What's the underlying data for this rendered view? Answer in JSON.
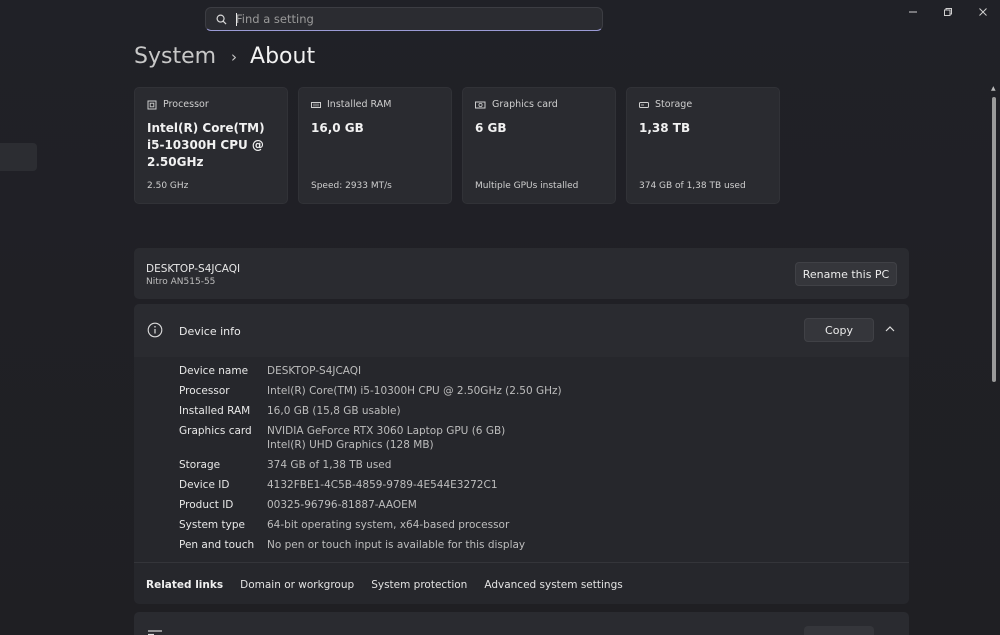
{
  "search": {
    "placeholder": "Find a setting"
  },
  "breadcrumb": {
    "parent": "System",
    "current": "About"
  },
  "cards": [
    {
      "label": "Processor",
      "icon": "processor-icon",
      "value": "Intel(R) Core(TM) i5-10300H CPU @ 2.50GHz",
      "sub": "2.50 GHz"
    },
    {
      "label": "Installed RAM",
      "icon": "ram-icon",
      "value": "16,0 GB",
      "sub": "Speed: 2933 MT/s"
    },
    {
      "label": "Graphics card",
      "icon": "graphics-card-icon",
      "value": "6 GB",
      "sub": "Multiple GPUs installed"
    },
    {
      "label": "Storage",
      "icon": "storage-icon",
      "value": "1,38 TB",
      "sub": "374 GB of 1,38 TB used"
    }
  ],
  "pc": {
    "name": "DESKTOP-S4JCAQI",
    "model": "Nitro AN515-55",
    "rename_label": "Rename this PC"
  },
  "device_info": {
    "title": "Device info",
    "copy_label": "Copy",
    "specs": [
      {
        "key": "Device name",
        "value": "DESKTOP-S4JCAQI"
      },
      {
        "key": "Processor",
        "value": "Intel(R) Core(TM) i5-10300H CPU @ 2.50GHz (2.50 GHz)"
      },
      {
        "key": "Installed RAM",
        "value": "16,0 GB (15,8 GB usable)"
      },
      {
        "key": "Graphics card",
        "value": "NVIDIA GeForce RTX 3060 Laptop GPU (6 GB)",
        "value2": "Intel(R) UHD Graphics (128 MB)"
      },
      {
        "key": "Storage",
        "value": "374 GB of 1,38 TB used"
      },
      {
        "key": "Device ID",
        "value": "4132FBE1-4C5B-4859-9789-4E544E3272C1"
      },
      {
        "key": "Product ID",
        "value": "00325-96796-81887-AAOEM"
      },
      {
        "key": "System type",
        "value": "64-bit operating system, x64-based processor"
      },
      {
        "key": "Pen and touch",
        "value": "No pen or touch input is available for this display"
      }
    ]
  },
  "related": {
    "title": "Related links",
    "links": [
      "Domain or workgroup",
      "System protection",
      "Advanced system settings"
    ]
  }
}
